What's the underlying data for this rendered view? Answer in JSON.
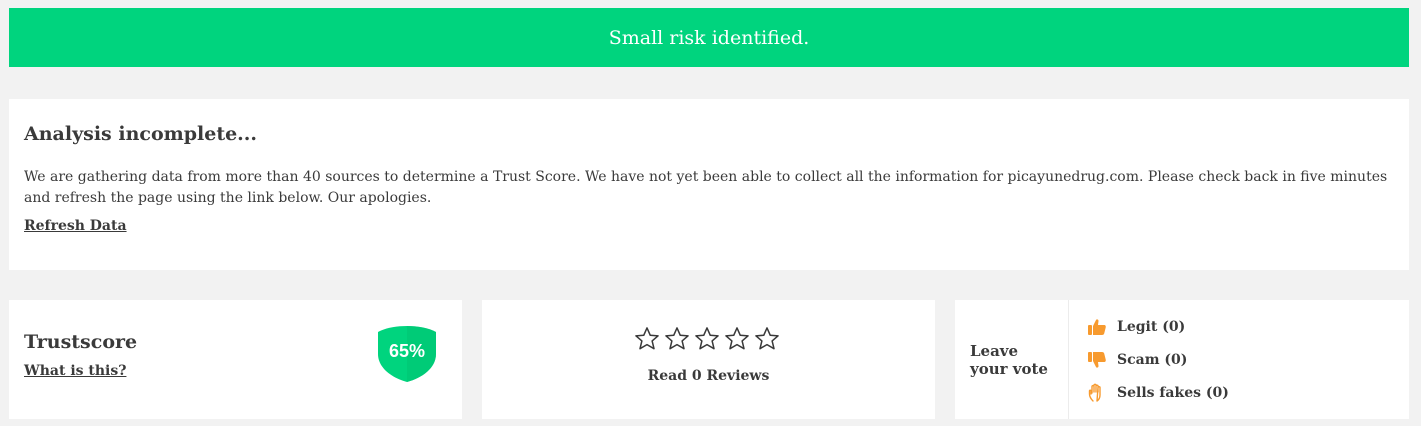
{
  "banner": {
    "message": "Small risk identified."
  },
  "analysis": {
    "title": "Analysis incomplete...",
    "body": "We are gathering data from more than 40 sources to determine a Trust Score. We have not yet been able to collect all the information for picayunedrug.com. Please check back in five minutes and refresh the page using the link below. Our apologies.",
    "refresh_link": "Refresh Data"
  },
  "trustscore": {
    "title": "Trustscore",
    "what_link": "What is this?",
    "score": "65%",
    "badge_color": "#00d47e"
  },
  "reviews": {
    "rating_stars": 0,
    "max_stars": 5,
    "read_link": "Read 0 Reviews"
  },
  "vote": {
    "prompt_line1": "Leave",
    "prompt_line2": "your vote",
    "options": [
      {
        "label": "Legit (0)",
        "icon": "thumbs-up-icon"
      },
      {
        "label": "Scam (0)",
        "icon": "thumbs-down-icon"
      },
      {
        "label": "Sells fakes (0)",
        "icon": "hand-icon"
      }
    ],
    "icon_color": "#f79a2e"
  }
}
